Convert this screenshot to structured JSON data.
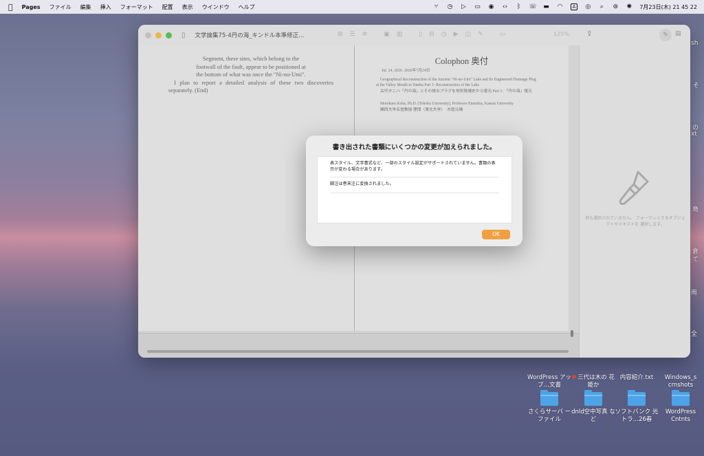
{
  "menubar": {
    "apple": "",
    "app_name": "Pages",
    "menus": [
      "ファイル",
      "編集",
      "挿入",
      "フォーマット",
      "配置",
      "表示",
      "ウインドウ",
      "ヘルプ"
    ],
    "input_mode": "A",
    "datetime": "7月23日(木) 21 45 22"
  },
  "desktop": {
    "partial_labels": [
      "sh",
      "そ",
      "の",
      "xt",
      "島",
      "倉",
      "て",
      "雨",
      "全"
    ],
    "icons": [
      {
        "label": "WordPress アップ…文書",
        "type": "folder"
      },
      {
        "label": "三代は木の 花姫か",
        "type": "file",
        "tag_color": "#e0453a"
      },
      {
        "label": "内容紹介.txt",
        "type": "text"
      },
      {
        "label": "Windows_s crnshots",
        "type": "folder"
      },
      {
        "label": "さくらサーバ ーファイル",
        "type": "folder"
      },
      {
        "label": "dnld空中写真 など",
        "type": "folder"
      },
      {
        "label": "ソフトバンク 光トラ…26春",
        "type": "folder"
      },
      {
        "label": "WordPress Cntnts",
        "type": "folder"
      }
    ]
  },
  "window": {
    "title": "文学論集75-4丹の海_キンドル本準修正...",
    "zoom": "125%",
    "left_page": {
      "lines_center": [
        "Segment, these sites, which belong to the",
        "footwall of the fault, appear to be positioned at",
        "the bottom of what was once the \"Ni-no-Umi\"."
      ],
      "paragraph": "I plan to report a detailed analysis of these two discoveries separately. (End)"
    },
    "right_page": {
      "title": "Colophon 奥付",
      "date": "Jul. 24, 2026. 2026年7月24日",
      "title_en": "Geographical Reconstruction of the Ancient \"Ni-no-Umi\" Lake and Its Engineered Drainage Plug at the Valley Mouth in Tamba Part 1: Reconstruction of the Lake",
      "title_jp": "古代タニハ「丹の海」とその排水プラグを地形発達史から復元 Part 1: 「丹の海」復元",
      "author_en": "Motoharu Koba, Ph.D. (Tohoku University), Professor Emeritus, Kansai University",
      "author_jp": "関西大学名誉教授 理博（東北大学）　木庭元晴"
    },
    "inspector": {
      "empty_text": "何も選択されていません。 フォーマットするオブジェクトやテキストを 選択します。"
    }
  },
  "dialog": {
    "title": "書き出された書類にいくつかの変更が加えられました。",
    "messages": [
      "表スタイル、文字書式など、一部のスタイル設定がサポートされていません。書類の表示が変わる場合があります。",
      "脚注は巻末注に変換されました。"
    ],
    "ok_label": "OK",
    "ok_color": "#f0a040"
  }
}
